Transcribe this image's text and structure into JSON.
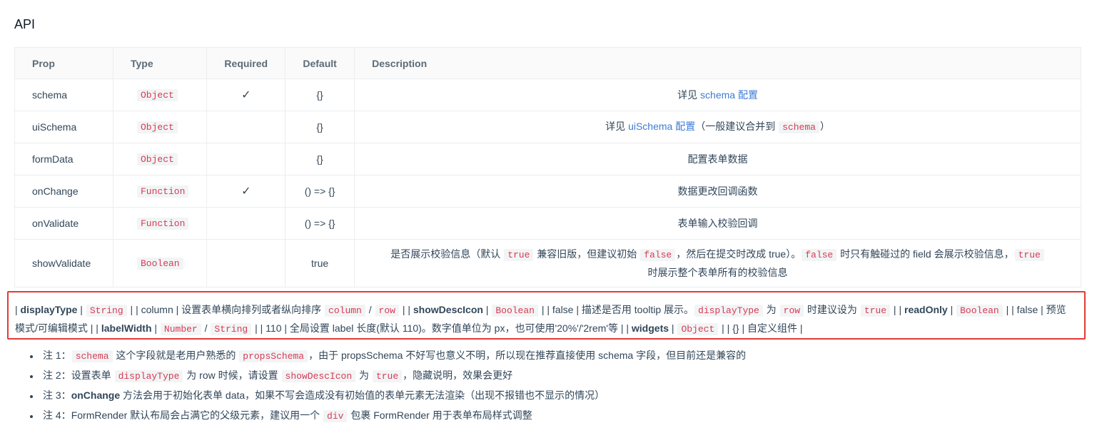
{
  "section_title": "API",
  "table": {
    "headers": [
      "Prop",
      "Type",
      "Required",
      "Default",
      "Description"
    ],
    "rows": [
      {
        "prop": "schema",
        "type": "Object",
        "required": "✓",
        "default": "{}",
        "desc_before": "详见 ",
        "desc_link": "schema 配置",
        "desc_after": ""
      },
      {
        "prop": "uiSchema",
        "type": "Object",
        "required": "",
        "default": "{}",
        "desc_before": "详见 ",
        "desc_link": "uiSchema 配置",
        "desc_after": "（一般建议合并到 ",
        "desc_code": "schema",
        "desc_tail": "）"
      },
      {
        "prop": "formData",
        "type": "Object",
        "required": "",
        "default": "{}",
        "desc": "配置表单数据"
      },
      {
        "prop": "onChange",
        "type": "Function",
        "required": "✓",
        "default": "() => {}",
        "desc": "数据更改回调函数"
      },
      {
        "prop": "onValidate",
        "type": "Function",
        "required": "",
        "default": "() => {}",
        "desc": "表单输入校验回调"
      },
      {
        "prop": "showValidate",
        "type": "Boolean",
        "required": "",
        "default": "true",
        "desc_parts": {
          "t1": "是否展示校验信息（默认 ",
          "c1": "true",
          "t2": " 兼容旧版，但建议初始 ",
          "c2": "false",
          "t3": "，然后在提交时改成 true）。",
          "c3": "false",
          "t4": " 时只有触碰过的 field 会展示校验信息，",
          "c4": "true",
          "t5": " 时展示整个表单所有的校验信息"
        }
      }
    ]
  },
  "raw_block": {
    "s1": "| ",
    "b1": "displayType",
    "s2": " | ",
    "c1": "String",
    "s3": " | | column | 设置表单横向排列或者纵向排序 ",
    "c2": "column",
    "s4": " / ",
    "c3": "row",
    "s5": " | | ",
    "b2": "showDescIcon",
    "s6": " | ",
    "c4": "Boolean",
    "s7": " | | false | 描述是否用 tooltip 展示。",
    "c5": "displayType",
    "s8": " 为 ",
    "c6": "row",
    "s9": " 时建议设为 ",
    "c7": "true",
    "s10": " | | ",
    "b3": "readOnly",
    "s11": " | ",
    "c8": "Boolean",
    "s12": " | | false | 预览模式/可编辑模式 | | ",
    "b4": "labelWidth",
    "s13": " | ",
    "c9": "Number",
    "s14": " / ",
    "c10": "String",
    "s15": " | | 110 | 全局设置 label 长度(默认 110)。数字值单位为 px，也可使用'20%'/'2rem'等 | | ",
    "b5": "widgets",
    "s16": " | ",
    "c11": "Object",
    "s17": " | | {} | 自定义组件 |"
  },
  "notes": [
    {
      "t1": "注 1：",
      "c1": "schema",
      "t2": " 这个字段就是老用户熟悉的 ",
      "c2": "propsSchema",
      "t3": "，由于 propsSchema 不好写也意义不明，所以现在推荐直接使用 schema 字段，但目前还是兼容的"
    },
    {
      "t1": "注 2：",
      "t1b": "设置表单 ",
      "c1": "displayType",
      "t2": " 为 row 时候，请设置 ",
      "c2": "showDescIcon",
      "t3": " 为 ",
      "c3": "true",
      "t4": "，隐藏说明，效果会更好"
    },
    {
      "t1": "注 3：",
      "b1": "onChange",
      "t2": " 方法会用于初始化表单 data，如果不写会造成没有初始值的表单元素无法渲染（出现不报错也不显示的情况）"
    },
    {
      "t1": "注 4：",
      "t2": "FormRender 默认布局会占满它的父级元素，建议用一个 ",
      "c1": "div",
      "t3": " 包裹 FormRender 用于表单布局样式调整"
    }
  ]
}
